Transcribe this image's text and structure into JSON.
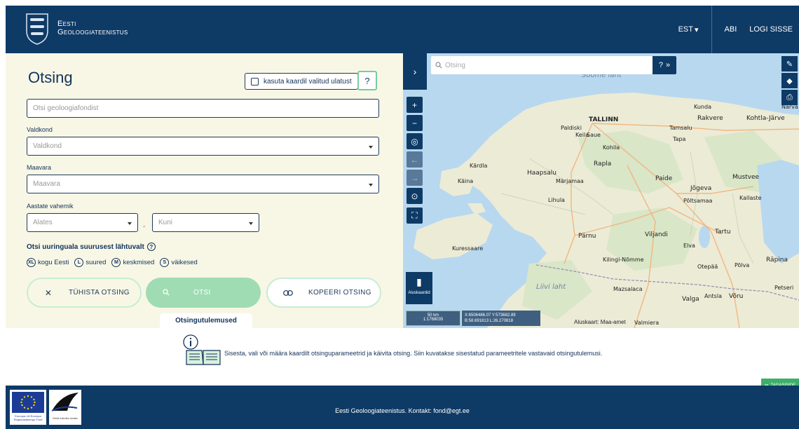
{
  "header": {
    "brand_line1": "Eesti",
    "brand_line2": "Geoloogiateenistus",
    "language": "EST",
    "help": "ABI",
    "login": "LOGI SISSE"
  },
  "search": {
    "title": "Otsing",
    "extent_label": "kasuta kaardil valitud ulatust",
    "help_label": "?",
    "keyword_placeholder": "Otsi geoloogiafondist",
    "field_label": "Valdkond",
    "field_placeholder": "Valdkond",
    "county_label": "Maavara",
    "county_placeholder": "Maavara",
    "years_label": "Aastate vahemik",
    "from_placeholder": "Alates",
    "dash": "-",
    "to_placeholder": "Kuni",
    "size_title": "Otsi uuringuala suurusest lähtuvalt",
    "size_help": "?",
    "sizes": [
      {
        "badge": "XL",
        "label": "kogu Eesti"
      },
      {
        "badge": "L",
        "label": "suured"
      },
      {
        "badge": "M",
        "label": "keskmised"
      },
      {
        "badge": "S",
        "label": "väikesed"
      }
    ],
    "clear_label": "TÜHISTA OTSING",
    "search_label": "OTSI",
    "copy_label": "KOPEERI OTSING",
    "results_tab": "Otsingutulemused"
  },
  "map": {
    "search_placeholder": "Otsing",
    "search_help": "?",
    "basemaps_label": "Aluskaardid",
    "scale_distance": "50 km",
    "scale_ratio": "1:1768035",
    "coords_xy": "X:6506486.07 Y:573682.89",
    "coords_bl": "B:58.691813 L:26.270818",
    "attribution": "Aluskaart: Maa-amet",
    "labels": {
      "tallinn": "TALLINN",
      "keila": "Keila",
      "paldiski": "Paldiski",
      "saue": "Saue",
      "kohila": "Kohila",
      "rapla": "Rapla",
      "haapsalu": "Haapsalu",
      "marjamaa": "Märjamaa",
      "lihula": "Lihula",
      "parnu": "Pärnu",
      "paide": "Paide",
      "tamsalu": "Tamsalu",
      "rakvere": "Rakvere",
      "kunda": "Kunda",
      "kohtla": "Kohtla-Järve",
      "narva": "Narva",
      "tapa": "Tapa",
      "jogeva": "Jõgeva",
      "poltsamaa": "Põltsamaa",
      "mustvee": "Mustvee",
      "kallaste": "Kallaste",
      "tartu": "Tartu",
      "elva": "Elva",
      "viljandi": "Viljandi",
      "otepaa": "Otepää",
      "polva": "Põlva",
      "voru": "Võru",
      "valga": "Valga",
      "antsla": "Antsla",
      "rapina": "Räpina",
      "petseri": "Petseri",
      "kilingi": "Kilingi-Nõmme",
      "kuressaare": "Kuressaare",
      "kardla": "Kärdla",
      "kaina": "Käina",
      "valmiera": "Valmiera",
      "mazsalaca": "Mazsalaca",
      "sea_liivi": "Liivi laht",
      "sea_soome": "Soome laht"
    }
  },
  "results": {
    "info_text": "Sisesta, vali või määra kaardilt otsinguparameetrid ja käivita otsing. Siin kuvatakse sisestatud parameetritele vastavaid otsingutulemusi.",
    "feedback_label": "TAGASISIDE"
  },
  "footer": {
    "text": "Eesti Geoloogiateenistus. Kontakt: fond@egt.ee",
    "eu_caption": "Euroopa Liit Euroopa Regionaalarengu Fond",
    "ee_caption": "Eesti tuleviku heaks"
  },
  "colors": {
    "brand_navy": "#0e3a66",
    "panel_bg": "#f8f7e6",
    "accent_green": "#9fdcb3",
    "feedback_green": "#3fae6b"
  }
}
